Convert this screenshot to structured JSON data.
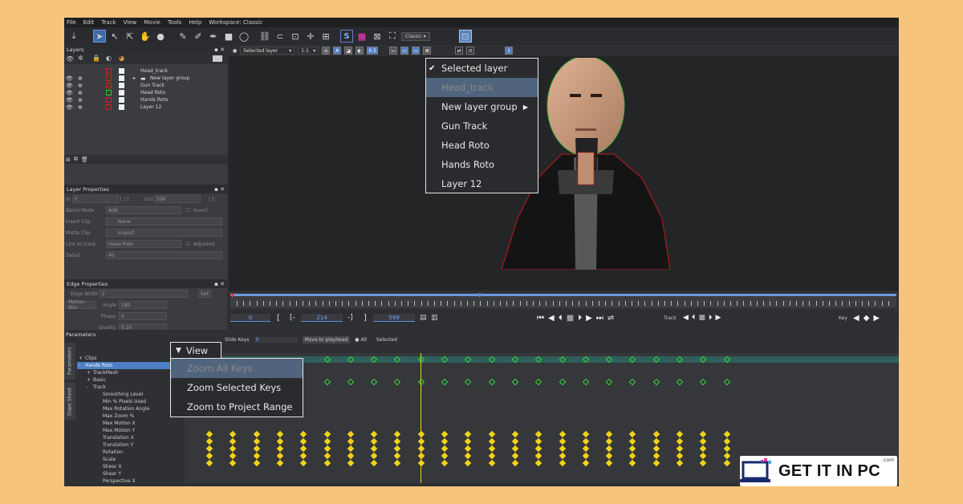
{
  "menu": {
    "items": [
      "File",
      "Edit",
      "Track",
      "View",
      "Movie",
      "Tools",
      "Help",
      "Workspace: Classic"
    ]
  },
  "toolbar": {
    "workspace_select": "Classic"
  },
  "layers_panel": {
    "title": "Layers",
    "items": [
      {
        "label": "Head_track",
        "type": "track",
        "indent": 0
      },
      {
        "label": "New layer group",
        "type": "group",
        "indent": 0
      },
      {
        "label": "Gun Track",
        "type": "track",
        "indent": 0
      },
      {
        "label": "Head Roto",
        "type": "roto",
        "indent": 0
      },
      {
        "label": "Hands Roto",
        "type": "roto",
        "indent": 0
      },
      {
        "label": "Layer 12",
        "type": "roto",
        "indent": 0
      }
    ]
  },
  "layer_properties": {
    "title": "Layer Properties",
    "in_label": "In",
    "in_value": "0",
    "out_label": "Out",
    "out_value": "599",
    "blend_mode_label": "Blend Mode",
    "blend_mode_value": "Add",
    "invert_label": "Invert",
    "insert_clip_label": "Insert Clip",
    "insert_clip_value": "None",
    "matte_clip_label": "Matte Clip",
    "matte_clip_value": "Import",
    "link_to_track_label": "Link to track",
    "link_to_track_value": "Head Roto",
    "adjusted_label": "Adjusted",
    "detail_label": "Detail",
    "detail_value": "40"
  },
  "edge_properties": {
    "title": "Edge Properties",
    "edge_width_label": "Edge Width",
    "edge_width_value": "2",
    "set_label": "Set",
    "motion_blur_label": "Motion Blur",
    "angle_label": "Angle",
    "angle_value": "180",
    "phase_label": "Phase",
    "phase_value": "0",
    "quality_label": "Quality",
    "quality_value": "0.25"
  },
  "viewer": {
    "layer_select": "Selected layer",
    "zoom_select": "1:1",
    "opacity_value": "0.5"
  },
  "layer_popup": {
    "items": [
      {
        "label": "Selected layer",
        "checked": true,
        "disabled": false,
        "submenu": false
      },
      {
        "label": "Head_track",
        "checked": false,
        "disabled": true,
        "submenu": false
      },
      {
        "label": "New layer group",
        "checked": false,
        "disabled": false,
        "submenu": true
      },
      {
        "label": "Gun Track",
        "checked": false,
        "disabled": false,
        "submenu": false
      },
      {
        "label": "Head Roto",
        "checked": false,
        "disabled": false,
        "submenu": false
      },
      {
        "label": "Hands Roto",
        "checked": false,
        "disabled": false,
        "submenu": false
      },
      {
        "label": "Layer 12",
        "checked": false,
        "disabled": false,
        "submenu": false
      }
    ]
  },
  "timeline": {
    "current_frame": "0",
    "in_frame": "214",
    "out_frame": "599",
    "track_label": "Track",
    "key_label": "Key"
  },
  "params": {
    "title": "Parameters",
    "tabs": [
      "Parameters",
      "Dope Sheet"
    ],
    "tree": [
      {
        "label": "Clips",
        "indent": 0,
        "expander": "+"
      },
      {
        "label": "Hands Roto",
        "indent": 0,
        "expander": "-",
        "selected": true
      },
      {
        "label": "TrackMesh",
        "indent": 1,
        "expander": "+"
      },
      {
        "label": "Basic",
        "indent": 1,
        "expander": "+"
      },
      {
        "label": "Track",
        "indent": 1,
        "expander": "-"
      },
      {
        "label": "Smoothing Level",
        "indent": 2
      },
      {
        "label": "Min % Pixels Used",
        "indent": 2
      },
      {
        "label": "Max Rotation Angle",
        "indent": 2
      },
      {
        "label": "Max Zoom %",
        "indent": 2
      },
      {
        "label": "Max Motion X",
        "indent": 2
      },
      {
        "label": "Max Motion Y",
        "indent": 2
      },
      {
        "label": "Translation X",
        "indent": 2
      },
      {
        "label": "Translation Y",
        "indent": 2
      },
      {
        "label": "Rotation",
        "indent": 2
      },
      {
        "label": "Scale",
        "indent": 2
      },
      {
        "label": "Shear X",
        "indent": 2
      },
      {
        "label": "Shear Y",
        "indent": 2
      },
      {
        "label": "Perspective X",
        "indent": 2
      }
    ],
    "slide_keys_label": "Slide Keys",
    "slide_keys_value": "0",
    "move_to_playhead_label": "Move to playhead",
    "all_label": "All",
    "selected_label": "Selected",
    "frames": [
      "205",
      "206",
      "207",
      "208",
      "209",
      "210",
      "211",
      "212",
      "213",
      "214",
      "215",
      "216",
      "217",
      "218",
      "219",
      "220",
      "221",
      "222",
      "223",
      "224",
      "225",
      "226",
      "227"
    ]
  },
  "view_popup": {
    "button_label": "View",
    "items": [
      {
        "label": "Zoom All Keys",
        "disabled": true
      },
      {
        "label": "Zoom Selected Keys",
        "disabled": false
      },
      {
        "label": "Zoom to Project Range",
        "disabled": false
      }
    ]
  },
  "watermark": {
    "text": "GET IT IN PC",
    "domain": ".com"
  },
  "colors": {
    "accent": "#4c7fc4",
    "page_bg": "#f7c57a",
    "key_green": "#3ad83a",
    "key_yellow": "#f2d21a",
    "roto_red": "#d02020"
  }
}
